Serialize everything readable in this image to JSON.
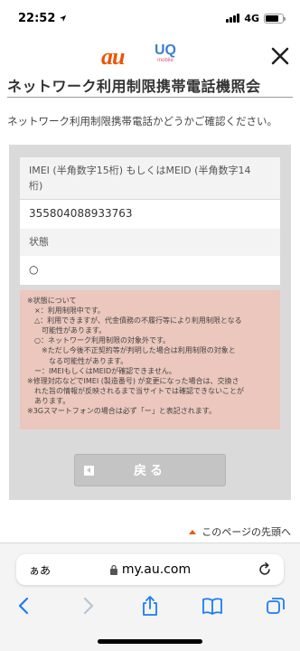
{
  "status_bar": {
    "time": "22:52",
    "network": "4G",
    "battery_level": 0.8
  },
  "header": {
    "brand_au": "au",
    "brand_uq": "UQ",
    "brand_uq_sub": "mobile"
  },
  "page": {
    "title": "ネットワーク利用制限携帯電話機照会",
    "intro": "ネットワーク利用制限携帯電話かどうかご確認ください。"
  },
  "form": {
    "imei_label_line1": "IMEI (半角数字15桁) もしくはMEID (半角数字14",
    "imei_label_line2": "桁)",
    "imei_value": "355804088933763",
    "status_label": "状態",
    "status_value": "○"
  },
  "notes": [
    "※状態について",
    "　×：利用制限中です。",
    "　△：利用できますが、代金債務の不履行等により利用制限となる",
    "　　可能性があります。",
    "　○：ネットワーク利用制限の対象外です。",
    "　　※ただし今後不正契約等が判明した場合は利用制限の対象と",
    "　　　なる可能性があります。",
    "　ー：IMEIもしくはMEIDが確認できません。",
    "※修理対応などでIMEI (製造番号) が変更になった場合は、交換さ",
    "　れた旨の情報が反映されるまで当サイトでは確認できないことが",
    "　あります。",
    "※3Gスマートフォンの場合は必ず「ー」と表記されます。"
  ],
  "buttons": {
    "back_label": "戻る"
  },
  "page_top_link": "このページの先頭へ",
  "browser": {
    "aa_label": "ぁあ",
    "url": "my.au.com"
  },
  "colors": {
    "accent": "#eb5505",
    "notes_bg": "#ebc7bd",
    "panel_bg": "#dadada",
    "ios_blue": "#1a7cf5"
  }
}
